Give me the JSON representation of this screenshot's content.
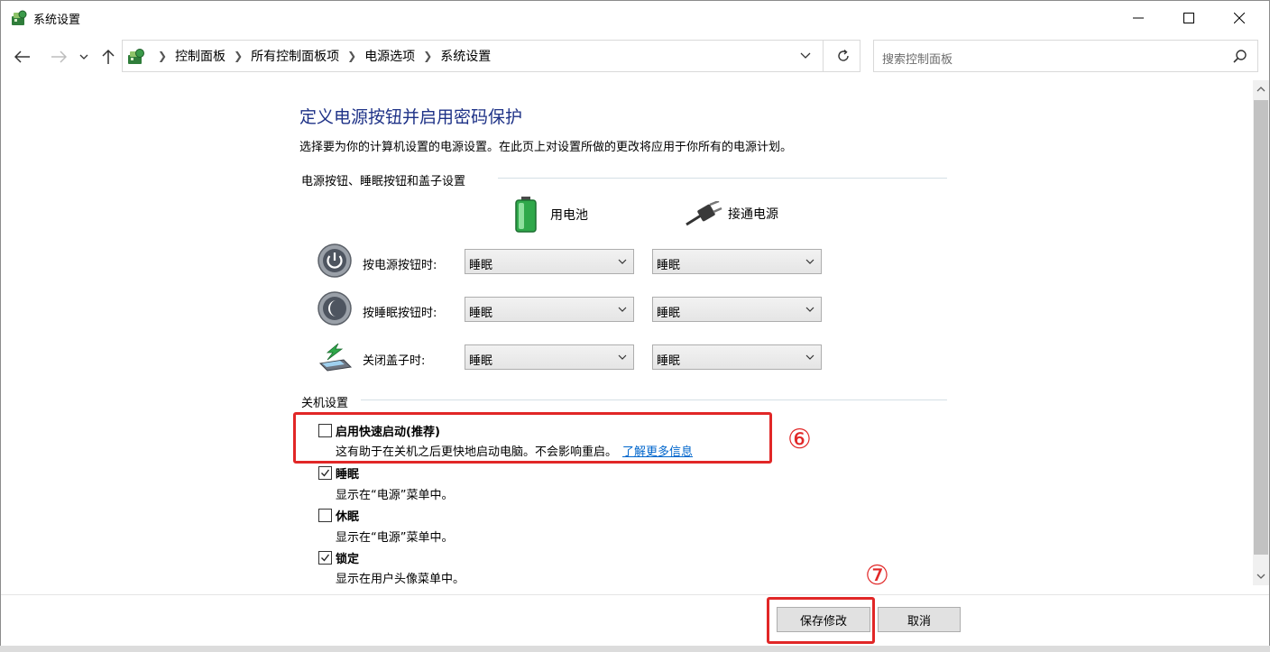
{
  "window": {
    "title": "系统设置"
  },
  "address": {
    "crumbs": [
      "控制面板",
      "所有控制面板项",
      "电源选项",
      "系统设置"
    ]
  },
  "search": {
    "placeholder": "搜索控制面板"
  },
  "page": {
    "title": "定义电源按钮并启用密码保护",
    "description": "选择要为你的计算机设置的电源设置。在此页上对设置所做的更改将应用于你所有的电源计划。"
  },
  "power_group": {
    "heading": "电源按钮、睡眠按钮和盖子设置",
    "col_battery": "用电池",
    "col_plugged": "接通电源",
    "rows": [
      {
        "label": "按电源按钮时:",
        "battery": "睡眠",
        "plugged": "睡眠"
      },
      {
        "label": "按睡眠按钮时:",
        "battery": "睡眠",
        "plugged": "睡眠"
      },
      {
        "label": "关闭盖子时:",
        "battery": "睡眠",
        "plugged": "睡眠"
      }
    ]
  },
  "shutdown_group": {
    "heading": "关机设置",
    "items": [
      {
        "title": "启用快速启动(推荐)",
        "desc": "这有助于在关机之后更快地启动电脑。不会影响重启。",
        "link": "了解更多信息",
        "checked": false
      },
      {
        "title": "睡眠",
        "desc": "显示在“电源”菜单中。",
        "checked": true
      },
      {
        "title": "休眠",
        "desc": "显示在“电源”菜单中。",
        "checked": false
      },
      {
        "title": "锁定",
        "desc": "显示在用户头像菜单中。",
        "checked": true
      }
    ]
  },
  "annotations": {
    "step6": "⑥",
    "step7": "⑦"
  },
  "buttons": {
    "save": "保存修改",
    "cancel": "取消"
  },
  "colors": {
    "title_blue": "#1e3287",
    "highlight_red": "#e12727",
    "link_blue": "#0066cc"
  }
}
